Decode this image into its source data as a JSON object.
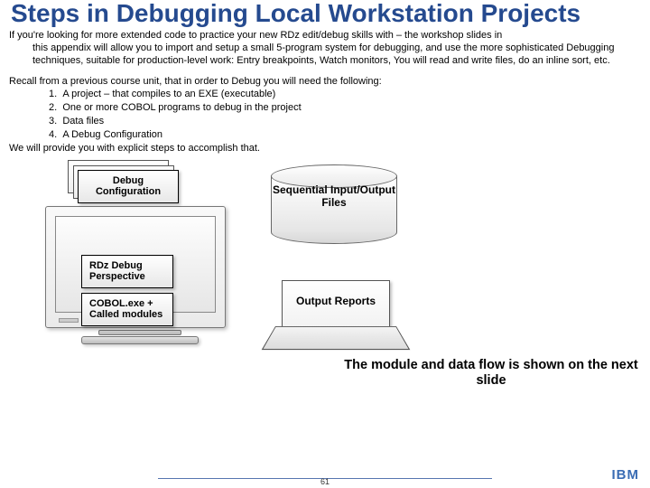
{
  "title": "Steps in Debugging Local Workstation Projects",
  "intro_line1": "If you're looking for more extended code to practice your new RDz edit/debug skills with – the workshop slides in",
  "intro_rest": "this appendix will allow you to import and setup a small 5-program system for debugging, and use the more sophisticated Debugging techniques, suitable for production-level work: Entry breakpoints, Watch monitors, You will read and write files, do an inline sort, etc.",
  "recall_intro": "Recall from a previous course unit, that in order to Debug you will need the following:",
  "recall_items": {
    "n1": "1.",
    "t1": "A project – that compiles to an EXE (executable)",
    "n2": "2.",
    "t2": "One or more COBOL programs to debug in the project",
    "n3": "3.",
    "t3": "Data files",
    "n4": "4.",
    "t4": "A Debug Configuration"
  },
  "recall_after": "We will provide you with explicit steps to accomplish that.",
  "boxes": {
    "debug_config": "Debug Configuration",
    "rdz_persp": "RDz Debug Perspective",
    "cobol_mod": "COBOL.exe + Called modules",
    "cyl_label": "Sequential Input/Output Files",
    "report_label": "Output Reports"
  },
  "next_slide": "The module and data flow is shown on the next slide",
  "page_number": "61",
  "logo": "IBM"
}
